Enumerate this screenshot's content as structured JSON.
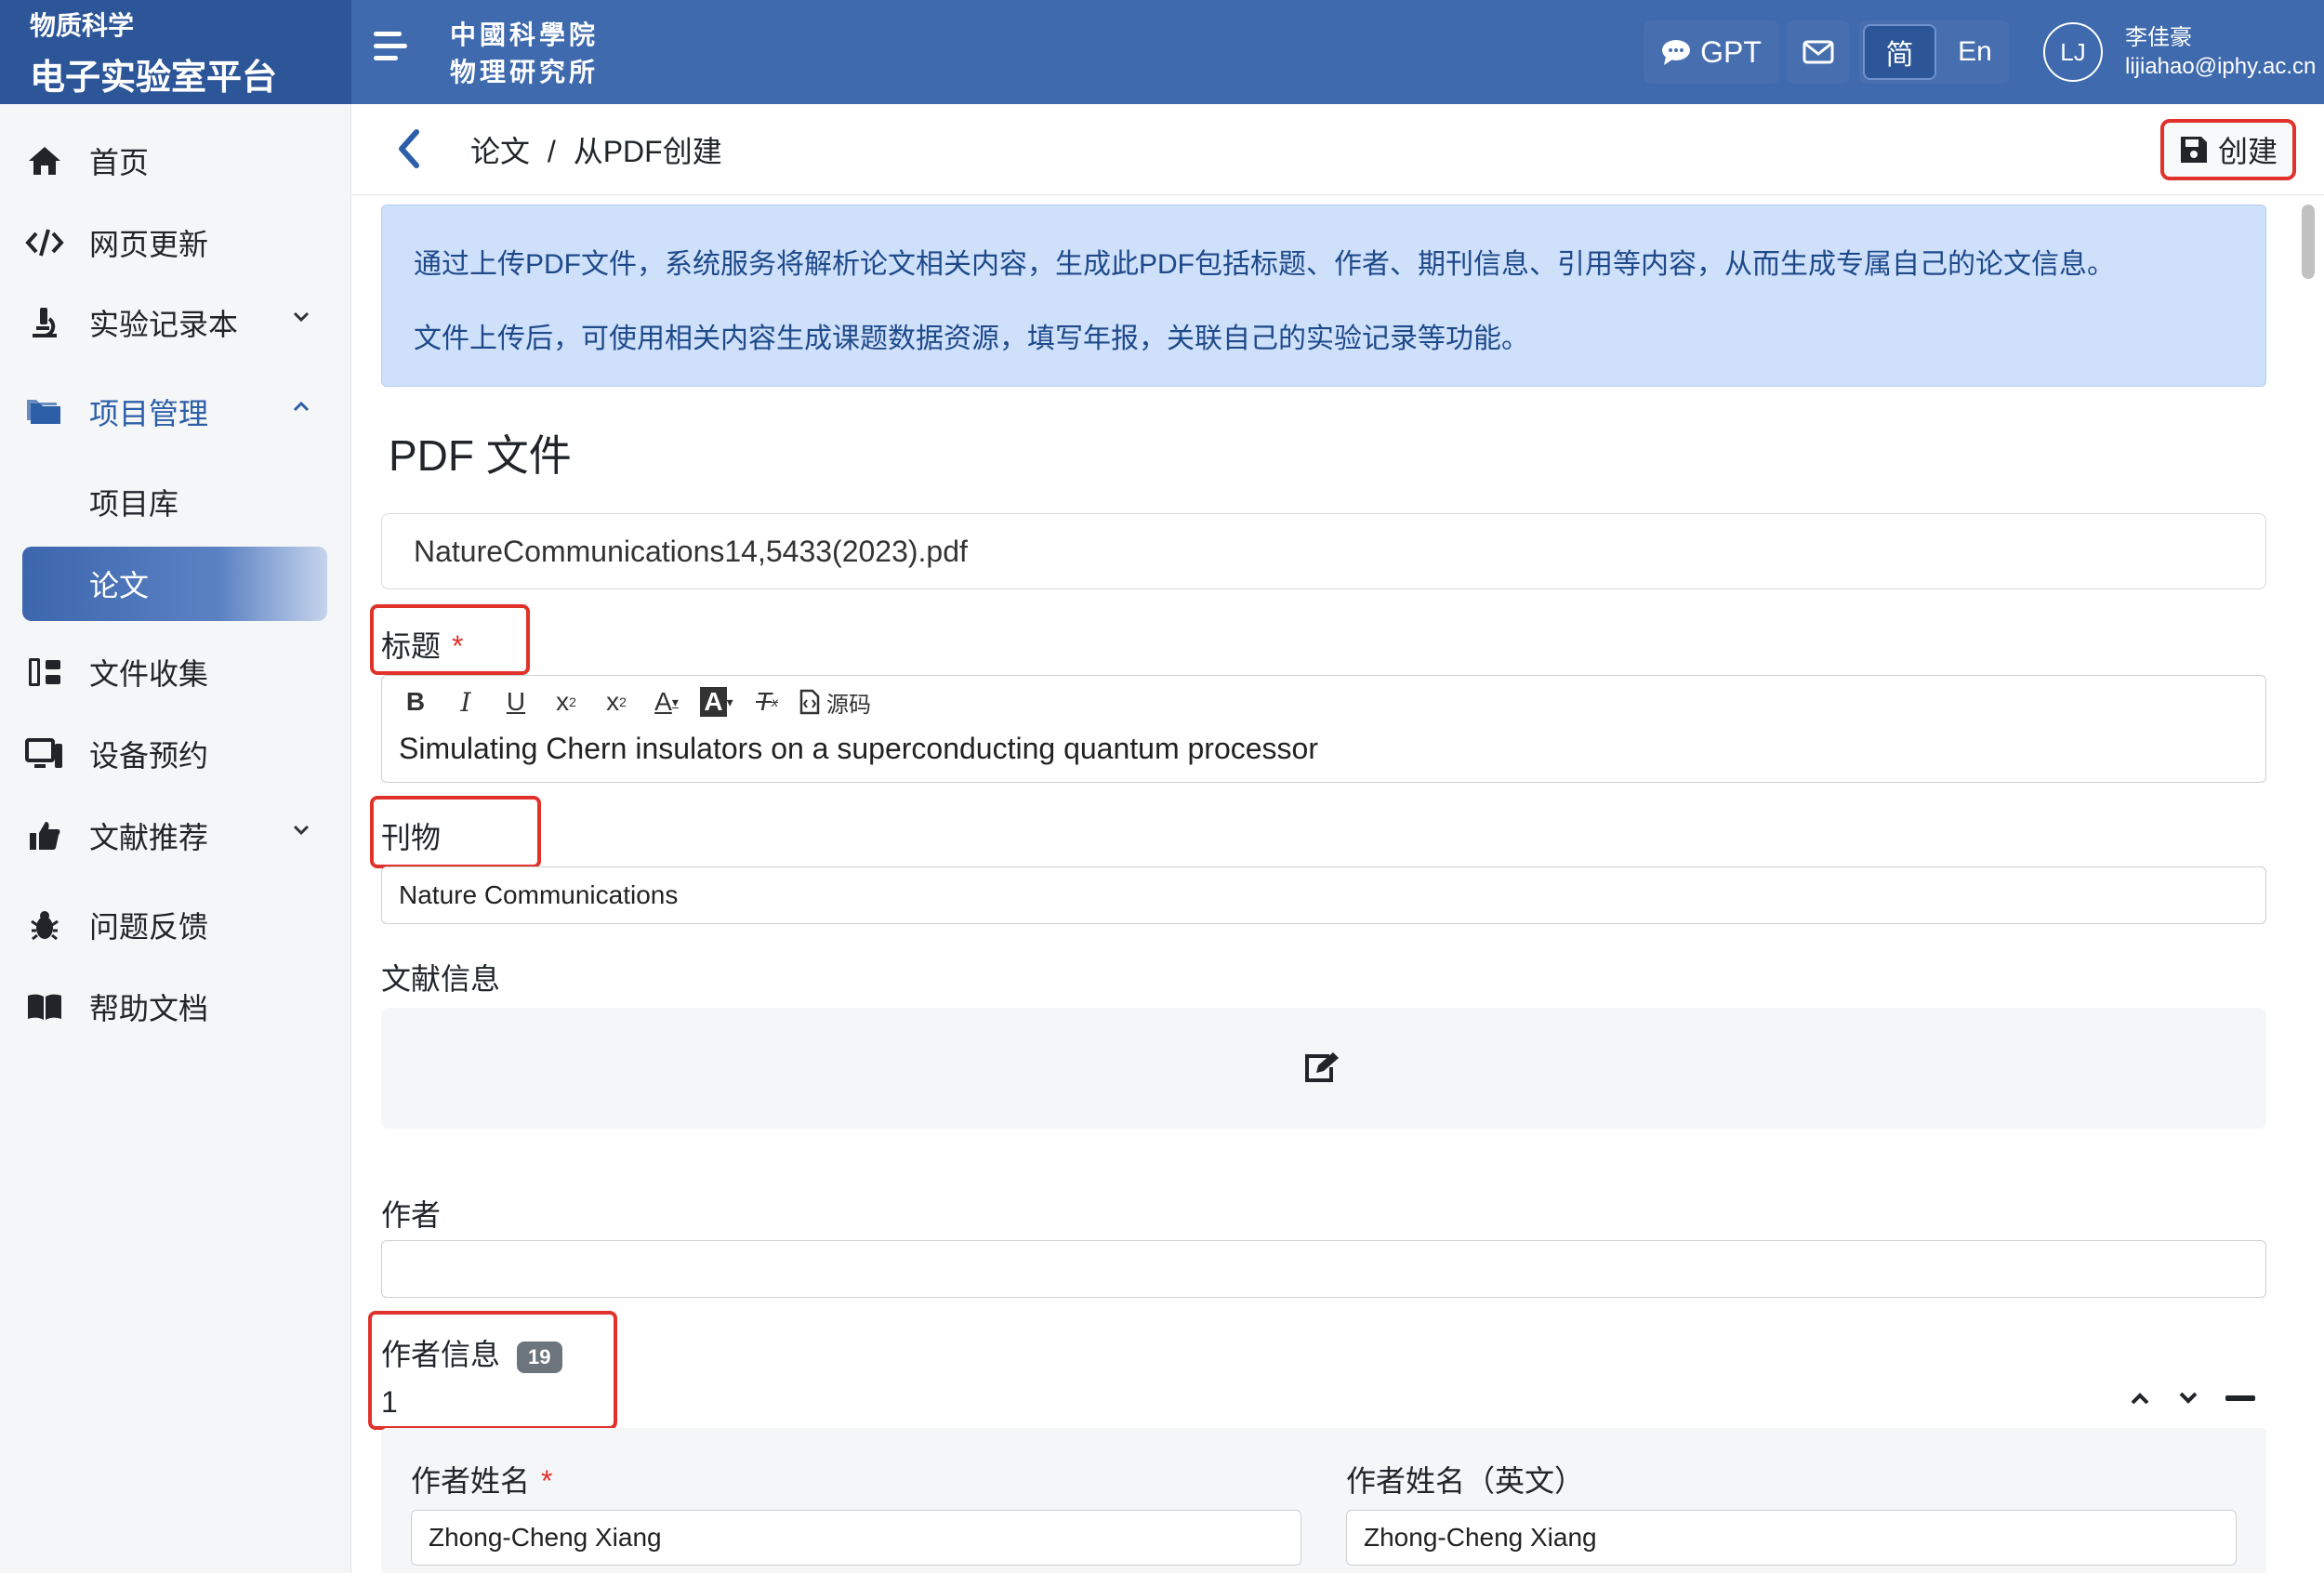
{
  "header": {
    "brand_small": "物质科学",
    "brand_big": "电子实验室平台",
    "logo_line1": "中國科學院",
    "logo_line2": "物理研究所",
    "gpt_label": "GPT",
    "lang_zh": "简",
    "lang_en": "En",
    "avatar_initials": "LJ",
    "user_name": "李佳豪",
    "user_email": "lijiahao@iphy.ac.cn"
  },
  "sidebar": {
    "home": "首页",
    "web_update": "网页更新",
    "lab_notebook": "实验记录本",
    "project_mgmt": "项目管理",
    "project_lib": "项目库",
    "papers": "论文",
    "file_collect": "文件收集",
    "device_booking": "设备预约",
    "lit_recommend": "文献推荐",
    "feedback": "问题反馈",
    "help_docs": "帮助文档"
  },
  "breadcrumb": {
    "parent": "论文",
    "sep": "/",
    "current": "从PDF创建"
  },
  "toolbar": {
    "create_label": "创建"
  },
  "alert": {
    "line1": "通过上传PDF文件，系统服务将解析论文相关内容，生成此PDF包括标题、作者、期刊信息、引用等内容，从而生成专属自己的论文信息。",
    "line2": "文件上传后，可使用相关内容生成课题数据资源，填写年报，关联自己的实验记录等功能。"
  },
  "form": {
    "section_title": "PDF 文件",
    "file_name": "NatureCommunications14,5433(2023).pdf",
    "title_label": "标题",
    "required_mark": "*",
    "editor_source_label": "源码",
    "title_value": "Simulating Chern insulators on a superconducting quantum processor",
    "journal_label": "刊物",
    "journal_value": "Nature Communications",
    "ref_label": "文献信息",
    "authors_label": "作者",
    "authors_value": "",
    "author_info_label": "作者信息",
    "author_count": "19",
    "author_index": "1",
    "author_name_label": "作者姓名",
    "author_name_en_label": "作者姓名（英文）",
    "author_name_value": "Zhong-Cheng Xiang",
    "author_name_en_value": "Zhong-Cheng Xiang"
  },
  "colors": {
    "topbar": "#3f6aad",
    "brand_bg": "#2d5699",
    "accent": "#2d5fa8",
    "highlight_red": "#e0322b",
    "alert_bg": "#cfe0fb"
  }
}
